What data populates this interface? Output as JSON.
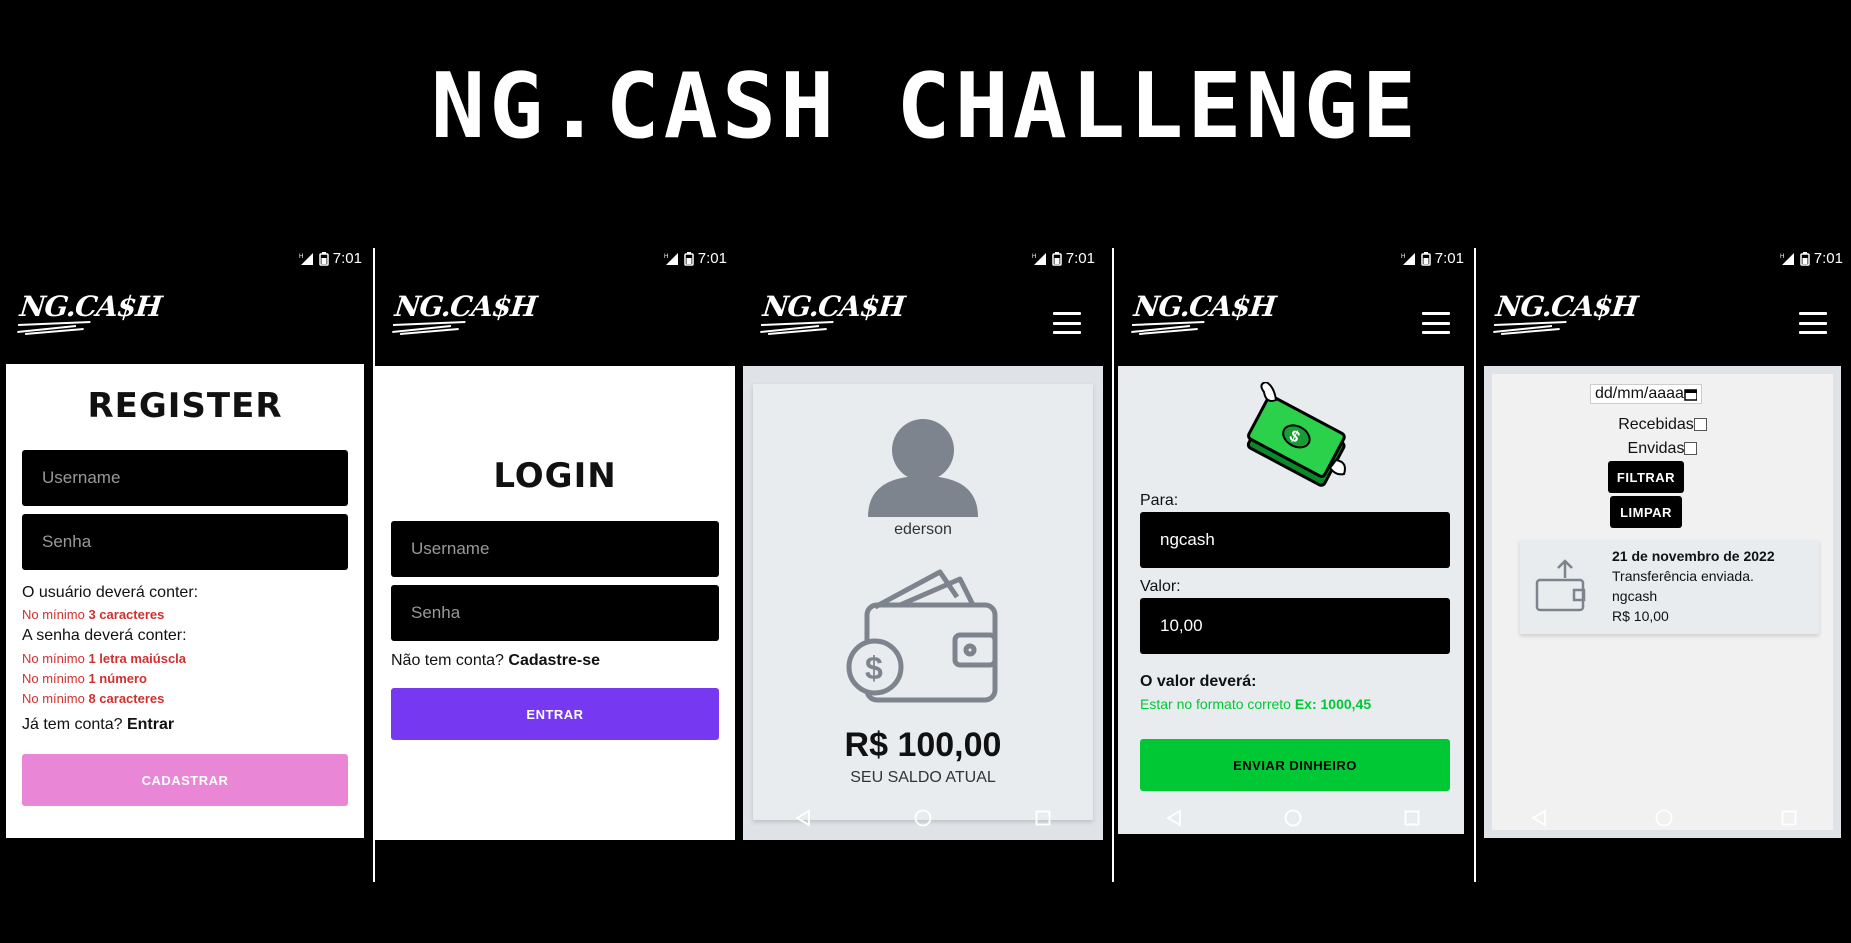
{
  "page_title": "NG.CASH CHALLENGE",
  "status": {
    "time": "7:01"
  },
  "logo_text": "NG.CA$H",
  "register": {
    "title": "REGISTER",
    "username_placeholder": "Username",
    "password_placeholder": "Senha",
    "user_rules_heading": "O usuário deverá conter:",
    "rule_prefix": "No mínimo ",
    "user_rule_1": "3 caracteres",
    "password_rules_heading": "A senha deverá conter:",
    "password_rule_1": "1 letra maiúscla",
    "password_rule_2": "1 número",
    "password_rule_3": "8 caracteres",
    "have_account_text": "Já tem conta?",
    "login_link": "Entrar",
    "submit_label": "CADASTRAR"
  },
  "login": {
    "title": "LOGIN",
    "username_placeholder": "Username",
    "password_placeholder": "Senha",
    "no_account_text": "Não tem conta?",
    "signup_link": "Cadastre-se",
    "submit_label": "ENTRAR"
  },
  "balance": {
    "username": "ederson",
    "amount": "R$ 100,00",
    "caption": "SEU SALDO ATUAL"
  },
  "transfer": {
    "to_label": "Para:",
    "to_value": "ngcash",
    "amount_label": "Valor:",
    "amount_value": "10,00",
    "rule_heading": "O valor deverá:",
    "rule_text": "Estar no formato correto ",
    "rule_example": "Ex: 1000,45",
    "submit_label": "ENVIAR DINHEIRO"
  },
  "transactions": {
    "date_placeholder": "dd/mm/aaaa",
    "received_label": "Recebidas",
    "sent_label": "Envidas",
    "filter_label": "FILTRAR",
    "clear_label": "LIMPAR",
    "items": [
      {
        "date": "21 de novembro de 2022",
        "type": "Transferência enviada.",
        "counterpart": "ngcash",
        "amount": "R$ 10,00"
      }
    ]
  },
  "colors": {
    "purple": "#7638f0",
    "pink": "#e986d6",
    "green": "#00c835",
    "red": "#d32f2f",
    "light_gray": "#e9ecef"
  }
}
